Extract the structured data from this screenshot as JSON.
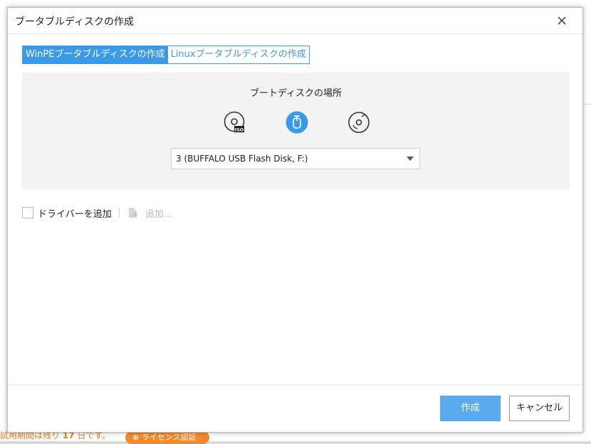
{
  "background": {
    "status_prefix": "試用期間は残り",
    "status_days": "17",
    "status_suffix": "日です。",
    "license_button": "ライセンス認証"
  },
  "dialog": {
    "title": "ブータブルディスクの作成",
    "close_icon": "close-icon"
  },
  "tabs": [
    {
      "label": "WinPEブータブルディスクの作成",
      "active": true
    },
    {
      "label": "Linuxブータブルディスクの作成",
      "active": false
    }
  ],
  "boot_location": {
    "heading": "ブートディスクの場所",
    "media": [
      {
        "name": "iso-image-icon",
        "selected": false
      },
      {
        "name": "usb-drive-icon",
        "selected": true
      },
      {
        "name": "cd-dvd-icon",
        "selected": false
      }
    ],
    "selected_device": "3 (BUFFALO USB Flash Disk, F:)"
  },
  "driver": {
    "checkbox_label": "ドライバーを追加",
    "add_label": "追加..."
  },
  "buttons": {
    "create": "作成",
    "cancel": "キャンセル"
  },
  "colors": {
    "accent": "#3a9ae8",
    "primary_button": "#5aaaf0",
    "status_orange": "#e87a1a"
  }
}
